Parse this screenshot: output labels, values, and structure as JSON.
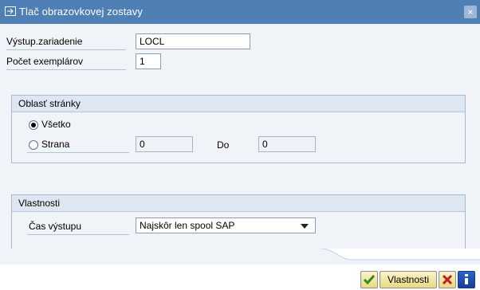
{
  "window": {
    "title": "Tlač obrazovkovej zostavy",
    "close_glyph": "×"
  },
  "fields": {
    "output_device_label": "Výstup.zariadenie",
    "output_device_value": "LOCL",
    "copies_label": "Počet exemplárov",
    "copies_value": "1"
  },
  "page_area": {
    "title": "Oblasť stránky",
    "all_label": "Všetko",
    "page_label": "Strana",
    "from_value": "0",
    "to_label": "Do",
    "to_value": "0"
  },
  "properties": {
    "title": "Vlastnosti",
    "output_time_label": "Čas výstupu",
    "output_time_value": "Najskôr len spool SAP"
  },
  "footer": {
    "properties_button": "Vlastnosti",
    "icons": [
      "check-icon",
      "cancel-icon",
      "info-icon"
    ]
  }
}
